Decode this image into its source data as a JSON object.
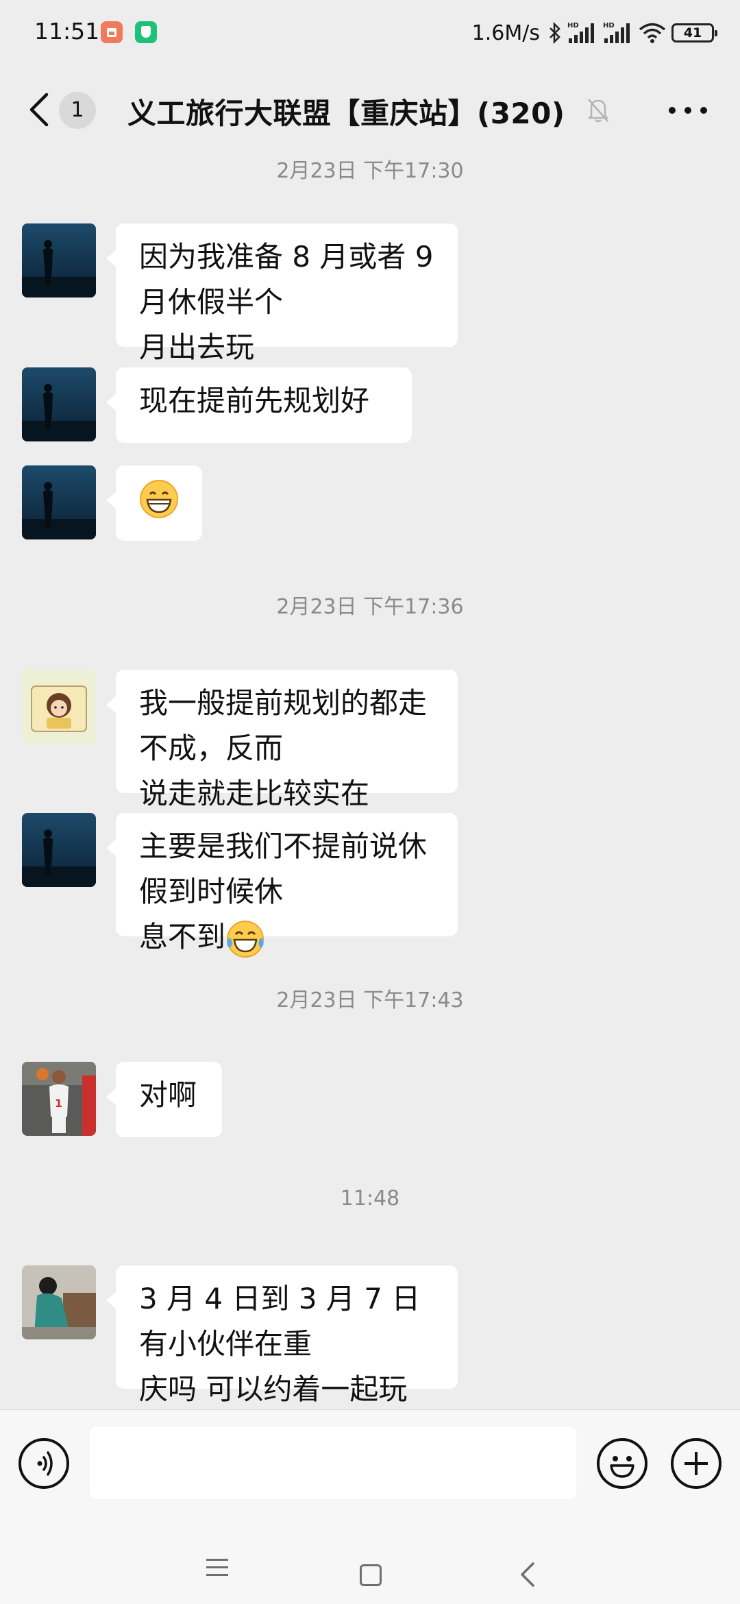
{
  "status_bar": {
    "time": "11:51",
    "speed": "1.6M/s",
    "battery": "41",
    "icons": [
      "notification-app-icon",
      "security-app-icon",
      "bluetooth-icon",
      "signal-hd-icon",
      "signal-hd-icon",
      "wifi-icon",
      "battery-icon"
    ]
  },
  "header": {
    "unread_count": "1",
    "title": "义工旅行大联盟【重庆站】(320)",
    "icons": [
      "back-icon",
      "mute-bell-icon",
      "more-icon"
    ]
  },
  "messages": [
    {
      "type": "timestamp",
      "text": "2月23日 下午17:30"
    },
    {
      "type": "message",
      "avatar": "avatar-silhouette-sea",
      "lines": [
        "因为我准备 8 月或者 9 月休假半个",
        "月出去玩"
      ]
    },
    {
      "type": "message",
      "avatar": "avatar-silhouette-sea",
      "lines": [
        "现在提前先规划好"
      ]
    },
    {
      "type": "message",
      "avatar": "avatar-silhouette-sea",
      "emoji": "grinning-face-emoji"
    },
    {
      "type": "timestamp",
      "text": "2月23日 下午17:36"
    },
    {
      "type": "message",
      "avatar": "avatar-cartoon-girl",
      "lines": [
        "我一般提前规划的都走不成，反而",
        "说走就走比较实在"
      ]
    },
    {
      "type": "message",
      "avatar": "avatar-silhouette-sea",
      "lines": [
        "主要是我们不提前说休假到时候休",
        "息不到"
      ],
      "trailing_emoji": "tears-of-joy-emoji"
    },
    {
      "type": "timestamp",
      "text": "2月23日 下午17:43"
    },
    {
      "type": "message",
      "avatar": "avatar-basketball-player",
      "lines": [
        "对啊"
      ]
    },
    {
      "type": "timestamp",
      "text": "11:48"
    },
    {
      "type": "message",
      "avatar": "avatar-woman-bench",
      "lines": [
        "3 月 4 日到 3 月 7 日有小伙伴在重",
        "庆吗 可以约着一起玩"
      ]
    }
  ],
  "input_bar": {
    "value": "",
    "icons": [
      "voice-icon",
      "emoji-icon",
      "plus-icon"
    ]
  },
  "nav_bar": {
    "icons": [
      "menu-icon",
      "home-icon",
      "back-nav-icon"
    ]
  }
}
